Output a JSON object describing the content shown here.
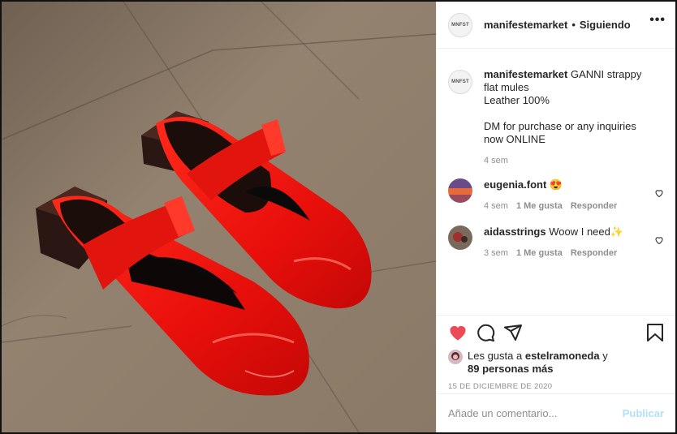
{
  "header": {
    "avatar_text": "MNFST",
    "username": "manifestemarket",
    "dot": "•",
    "follow_status": "Siguiendo",
    "more": "•••"
  },
  "caption": {
    "username": "manifestemarket",
    "lines": [
      "GANNI strappy",
      "flat mules",
      "Leather 100%",
      "",
      "DM for purchase or any inquiries",
      "now ONLINE"
    ],
    "time": "4 sem"
  },
  "comments": [
    {
      "username": "eugenia.font",
      "text": "😍",
      "time": "4 sem",
      "likes": "1 Me gusta",
      "reply": "Responder"
    },
    {
      "username": "aidasstrings",
      "text": "Woow I need✨",
      "time": "3 sem",
      "likes": "1 Me gusta",
      "reply": "Responder"
    }
  ],
  "likes": {
    "prefix": "Les gusta a",
    "user": "estelramoneda",
    "conj": "y",
    "others": "89 personas más"
  },
  "date": "15 DE DICIEMBRE DE 2020",
  "add_comment": {
    "placeholder": "Añade un comentario...",
    "publish": "Publicar"
  },
  "colors": {
    "like_red": "#ed4956",
    "publish_blue": "#b2dffc",
    "meta_gray": "#8e8e8e"
  }
}
